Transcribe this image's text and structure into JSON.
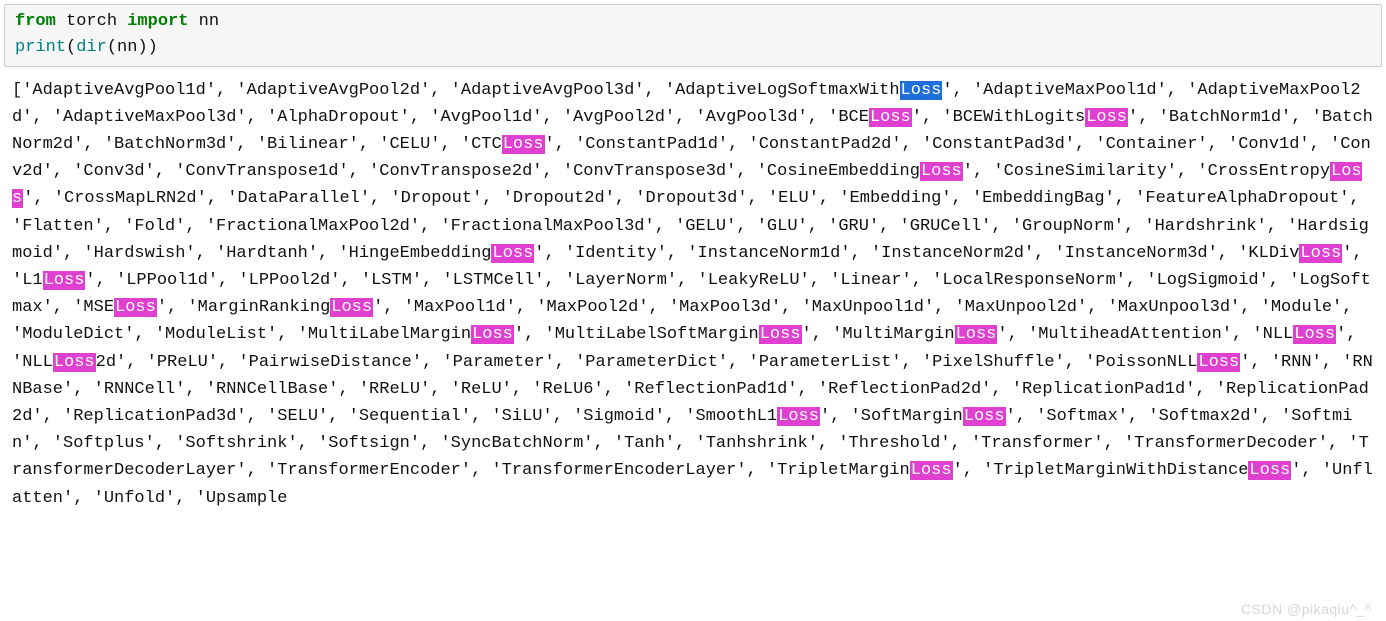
{
  "code": {
    "kw_from": "from",
    "mod": "torch",
    "kw_import": "import",
    "name": "nn",
    "fn_print": "print",
    "fn_dir": "dir",
    "arg": "nn"
  },
  "watermark": "CSDN @pikaqiu^_^",
  "output_segments": [
    {
      "t": "['AdaptiveAvgPool1d', 'AdaptiveAvgPool2d', 'AdaptiveAvgPool3d', 'AdaptiveLogSoftmaxWith"
    },
    {
      "t": "Loss",
      "c": "blue"
    },
    {
      "t": "', 'AdaptiveMaxPool1d', 'AdaptiveMaxPool2d', 'AdaptiveMaxPool3d', 'AlphaDropout', 'AvgPool1d', 'AvgPool2d', 'AvgPool3d', 'BCE"
    },
    {
      "t": "Loss",
      "c": "pink"
    },
    {
      "t": "', 'BCEWithLogits"
    },
    {
      "t": "Loss",
      "c": "pink"
    },
    {
      "t": "', 'BatchNorm1d', 'BatchNorm2d', 'BatchNorm3d', 'Bilinear', 'CELU', 'CTC"
    },
    {
      "t": "Loss",
      "c": "pink"
    },
    {
      "t": "', 'ConstantPad1d', 'ConstantPad2d', 'ConstantPad3d', 'Container', 'Conv1d', 'Conv2d', 'Conv3d', 'ConvTranspose1d', 'ConvTranspose2d', 'ConvTranspose3d', 'CosineEmbedding"
    },
    {
      "t": "Loss",
      "c": "pink"
    },
    {
      "t": "', 'CosineSimilarity', 'CrossEntropy"
    },
    {
      "t": "Loss",
      "c": "pink"
    },
    {
      "t": "', 'CrossMapLRN2d', 'DataParallel', 'Dropout', 'Dropout2d', 'Dropout3d', 'ELU', 'Embedding', 'EmbeddingBag', 'FeatureAlphaDropout', 'Flatten', 'Fold', 'FractionalMaxPool2d', 'FractionalMaxPool3d', 'GELU', 'GLU', 'GRU', 'GRUCell', 'GroupNorm', 'Hardshrink', 'Hardsigmoid', 'Hardswish', 'Hardtanh', 'HingeEmbedding"
    },
    {
      "t": "Loss",
      "c": "pink"
    },
    {
      "t": "', 'Identity', 'InstanceNorm1d', 'InstanceNorm2d', 'InstanceNorm3d', 'KLDiv"
    },
    {
      "t": "Loss",
      "c": "pink"
    },
    {
      "t": "', 'L1"
    },
    {
      "t": "Loss",
      "c": "pink"
    },
    {
      "t": "', 'LPPool1d', 'LPPool2d', 'LSTM', 'LSTMCell', 'LayerNorm', 'LeakyReLU', 'Linear', 'LocalResponseNorm', 'LogSigmoid', 'LogSoftmax', 'MSE"
    },
    {
      "t": "Loss",
      "c": "pink"
    },
    {
      "t": "', 'MarginRanking"
    },
    {
      "t": "Loss",
      "c": "pink"
    },
    {
      "t": "', 'MaxPool1d', 'MaxPool2d', 'MaxPool3d', 'MaxUnpool1d', 'MaxUnpool2d', 'MaxUnpool3d', 'Module', 'ModuleDict', 'ModuleList', 'MultiLabelMargin"
    },
    {
      "t": "Loss",
      "c": "pink"
    },
    {
      "t": "', 'MultiLabelSoftMargin"
    },
    {
      "t": "Loss",
      "c": "pink"
    },
    {
      "t": "', 'MultiMargin"
    },
    {
      "t": "Loss",
      "c": "pink"
    },
    {
      "t": "', 'MultiheadAttention', 'NLL"
    },
    {
      "t": "Loss",
      "c": "pink"
    },
    {
      "t": "', 'NLL"
    },
    {
      "t": "Loss",
      "c": "pink"
    },
    {
      "t": "2d', 'PReLU', 'PairwiseDistance', 'Parameter', 'ParameterDict', 'ParameterList', 'PixelShuffle', 'PoissonNLL"
    },
    {
      "t": "Loss",
      "c": "pink"
    },
    {
      "t": "', 'RNN', 'RNNBase', 'RNNCell', 'RNNCellBase', 'RReLU', 'ReLU', 'ReLU6', 'ReflectionPad1d', 'ReflectionPad2d', 'ReplicationPad1d', 'ReplicationPad2d', 'ReplicationPad3d', 'SELU', 'Sequential', 'SiLU', 'Sigmoid', 'SmoothL1"
    },
    {
      "t": "Loss",
      "c": "pink"
    },
    {
      "t": "', 'SoftMargin"
    },
    {
      "t": "Loss",
      "c": "pink"
    },
    {
      "t": "', 'Softmax', 'Softmax2d', 'Softmin', 'Softplus', 'Softshrink', 'Softsign', 'SyncBatchNorm', 'Tanh', 'Tanhshrink', 'Threshold', 'Transformer', 'TransformerDecoder', 'TransformerDecoderLayer', 'TransformerEncoder', 'TransformerEncoderLayer', 'TripletMargin"
    },
    {
      "t": "Loss",
      "c": "pink"
    },
    {
      "t": "', 'TripletMarginWithDistance"
    },
    {
      "t": "Loss",
      "c": "pink"
    },
    {
      "t": "', 'Unflatten', 'Unfold', 'Upsample"
    }
  ]
}
